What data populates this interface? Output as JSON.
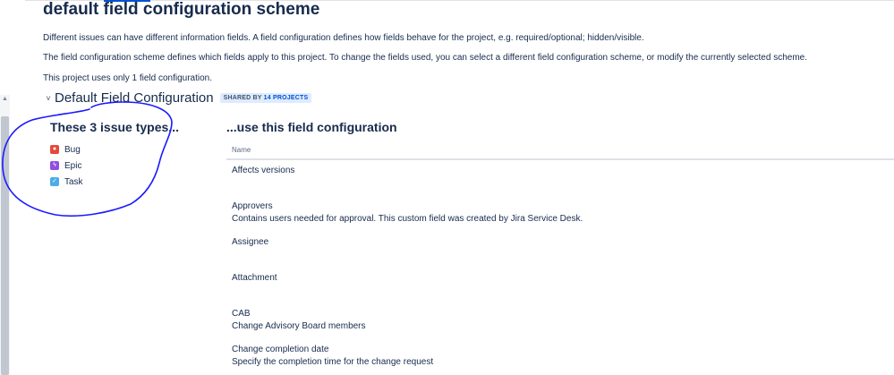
{
  "page": {
    "title": "default field configuration scheme",
    "descriptions": [
      "Different issues can have different information fields. A field configuration defines how fields behave for the project, e.g. required/optional; hidden/visible.",
      "The field configuration scheme defines which fields apply to this project. To change the fields used, you can select a different field configuration scheme, or modify the currently selected scheme.",
      "This project uses only 1 field configuration."
    ]
  },
  "config": {
    "title": "Default Field Configuration",
    "shared_prefix": "SHARED BY",
    "shared_count": "14 PROJECTS"
  },
  "issue_types": {
    "title": "These 3 issue types...",
    "items": [
      {
        "label": "Bug",
        "icon": "bug-icon",
        "color": "#e5493a"
      },
      {
        "label": "Epic",
        "icon": "epic-icon",
        "color": "#904ee2"
      },
      {
        "label": "Task",
        "icon": "task-icon",
        "color": "#4bade8"
      }
    ]
  },
  "fields": {
    "title": "...use this field configuration",
    "column_header": "Name",
    "rows": [
      {
        "name": "Affects versions",
        "description": ""
      },
      {
        "name": "Approvers",
        "description": "Contains users needed for approval. This custom field was created by Jira Service Desk."
      },
      {
        "name": "Assignee",
        "description": ""
      },
      {
        "name": "Attachment",
        "description": ""
      },
      {
        "name": "CAB",
        "description": "Change Advisory Board members"
      },
      {
        "name": "Change completion date",
        "description": "Specify the completion time for the change request"
      }
    ]
  },
  "colors": {
    "text": "#172b4d",
    "badge_bg": "#deebff",
    "link": "#0052cc",
    "annotation": "#1a1aff"
  }
}
